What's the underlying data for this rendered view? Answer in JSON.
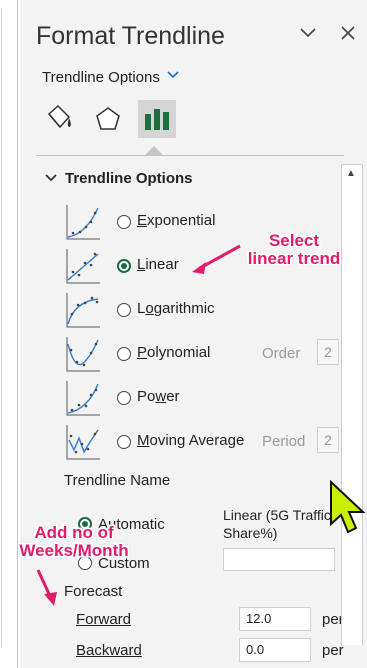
{
  "pane": {
    "title": "Format Trendline",
    "options_dropdown": "Trendline Options",
    "section_header": "Trendline Options"
  },
  "types": [
    {
      "label_pre": "",
      "label_u": "E",
      "label_post": "xponential"
    },
    {
      "label_pre": "",
      "label_u": "L",
      "label_post": "inear"
    },
    {
      "label_pre": "L",
      "label_u": "o",
      "label_post": "garithmic"
    },
    {
      "label_pre": "",
      "label_u": "P",
      "label_post": "olynomial"
    },
    {
      "label_pre": "Po",
      "label_u": "w",
      "label_post": "er"
    },
    {
      "label_pre": "",
      "label_u": "M",
      "label_post": "oving Average"
    }
  ],
  "selected_type": "Linear",
  "order": {
    "label": "Order",
    "value": "2"
  },
  "period": {
    "label": "Period",
    "value": "2"
  },
  "trendline_name": {
    "heading": "Trendline Name",
    "automatic_label": "Automatic",
    "custom_label": "Custom",
    "auto_value_line1": "Linear (5G Traffic",
    "auto_value_line2": "Share%)"
  },
  "forecast": {
    "heading": "Forecast",
    "forward_label": "Forward",
    "forward_value": "12.0",
    "backward_label": "Backward",
    "backward_value": "0.0",
    "unit": "per"
  },
  "annotations": {
    "select_line1": "Select",
    "select_line2": "linear trend",
    "add_line1": "Add no of",
    "add_line2": "Weeks/Month"
  },
  "colors": {
    "annotation": "#e31b6d",
    "radio_selected": "#1b6b3a",
    "cursor": "#c8f000"
  }
}
